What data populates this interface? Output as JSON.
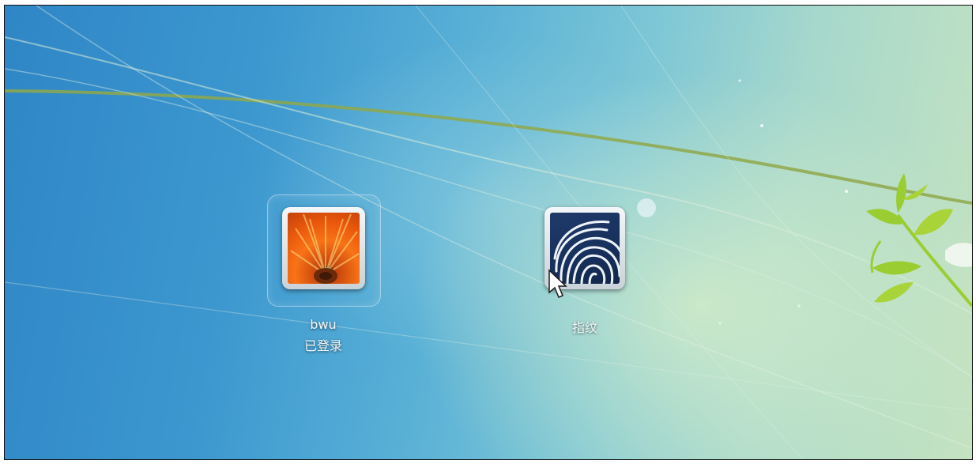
{
  "login_screen": {
    "user_tile": {
      "name": "bwu",
      "status": "已登录",
      "avatar_icon": "orange-flower-avatar"
    },
    "fingerprint_tile": {
      "label": "指纹",
      "icon": "fingerprint-icon"
    }
  },
  "colors": {
    "background_left": "#2f86c6",
    "background_right": "#c5e3c0",
    "leaf_green": "#9acd32",
    "text": "#f2f7fa",
    "fingerprint_bg": "#1f3a6a",
    "avatar_orange": "#f97316"
  }
}
